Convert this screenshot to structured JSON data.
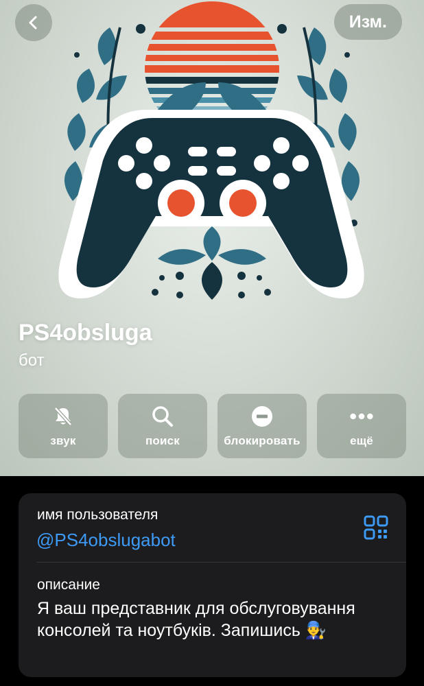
{
  "header": {
    "back_icon": "chevron-left-icon",
    "edit_label": "Изм."
  },
  "profile": {
    "name": "PS4obsluga",
    "status": "бот"
  },
  "actions": [
    {
      "label": "звук",
      "icon": "bell-slash-icon"
    },
    {
      "label": "поиск",
      "icon": "search-icon"
    },
    {
      "label": "блокировать",
      "icon": "block-icon"
    },
    {
      "label": "ещё",
      "icon": "more-icon"
    }
  ],
  "info": {
    "username_label": "имя пользователя",
    "username": "@PS4obslugabot",
    "description_label": "описание",
    "description": "Я ваш представник для обслуговування консолей та ноутбуків. Запишись 👨‍🔧"
  },
  "colors": {
    "link": "#3d9af5",
    "card_bg": "#1c1c1e",
    "logo_orange": "#e8532f",
    "logo_navy": "#15323f",
    "logo_teal": "#2f6e85"
  }
}
